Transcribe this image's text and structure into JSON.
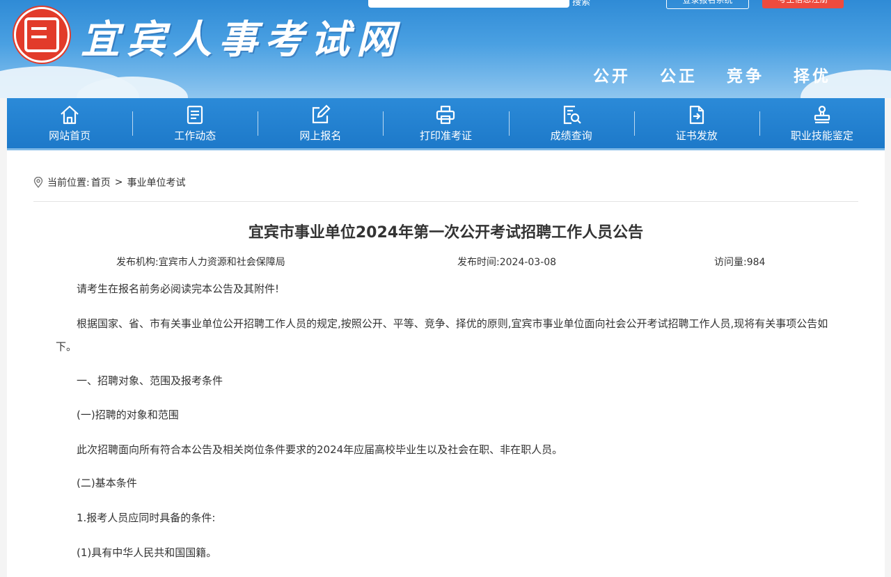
{
  "header": {
    "site_title": "宜宾人事考试网",
    "search_label": "搜索",
    "top_buttons": [
      "登录报名系统",
      "考生信息注册"
    ],
    "slogans": [
      "公开",
      "公正",
      "竞争",
      "择优"
    ]
  },
  "nav": {
    "items": [
      {
        "label": "网站首页",
        "icon": "home-icon"
      },
      {
        "label": "工作动态",
        "icon": "document-list-icon"
      },
      {
        "label": "网上报名",
        "icon": "edit-icon"
      },
      {
        "label": "打印准考证",
        "icon": "printer-icon"
      },
      {
        "label": "成绩查询",
        "icon": "search-document-icon"
      },
      {
        "label": "证书发放",
        "icon": "certificate-export-icon"
      },
      {
        "label": "职业技能鉴定",
        "icon": "stamp-icon"
      }
    ]
  },
  "breadcrumb": {
    "prefix": "当前位置:",
    "home": "首页",
    "separator": ">",
    "current": "事业单位考试"
  },
  "article": {
    "title": "宜宾市事业单位2024年第一次公开考试招聘工作人员公告",
    "publisher": "发布机构:宜宾市人力资源和社会保障局",
    "date": "发布时间:2024-03-08",
    "views": "访问量:984",
    "paragraphs": [
      "请考生在报名前务必阅读完本公告及其附件!",
      "根据国家、省、市有关事业单位公开招聘工作人员的规定,按照公开、平等、竞争、择优的原则,宜宾市事业单位面向社会公开考试招聘工作人员,现将有关事项公告如下。",
      "一、招聘对象、范围及报考条件",
      "(一)招聘的对象和范围",
      "此次招聘面向所有符合本公告及相关岗位条件要求的2024年应届高校毕业生以及社会在职、非在职人员。",
      "(二)基本条件",
      "1.报考人员应同时具备的条件:",
      "(1)具有中华人民共和国国籍。"
    ]
  }
}
